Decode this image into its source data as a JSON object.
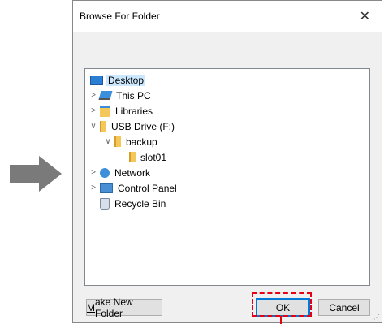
{
  "dialog": {
    "title": "Browse For Folder",
    "close_glyph": "✕"
  },
  "tree": {
    "items": [
      {
        "label": "Desktop",
        "icon": "desktop-icon",
        "selected": true
      },
      {
        "label": "This PC",
        "icon": "pc-icon",
        "expander": ">"
      },
      {
        "label": "Libraries",
        "icon": "libraries-icon",
        "expander": ">"
      },
      {
        "label": "USB Drive (F:)",
        "icon": "usb-drive-icon",
        "expander": "v"
      },
      {
        "label": "backup",
        "icon": "folder-icon",
        "expander": "v"
      },
      {
        "label": "slot01",
        "icon": "folder-icon"
      },
      {
        "label": "Network",
        "icon": "network-icon",
        "expander": ">"
      },
      {
        "label": "Control Panel",
        "icon": "control-panel-icon",
        "expander": ">"
      },
      {
        "label": "Recycle Bin",
        "icon": "recycle-bin-icon"
      }
    ]
  },
  "buttons": {
    "make_new_folder": "Make New Folder",
    "ok": "OK",
    "cancel": "Cancel"
  },
  "colors": {
    "highlight": "#e60012",
    "selection": "#cce8ff",
    "default_button_border": "#0078d7"
  }
}
